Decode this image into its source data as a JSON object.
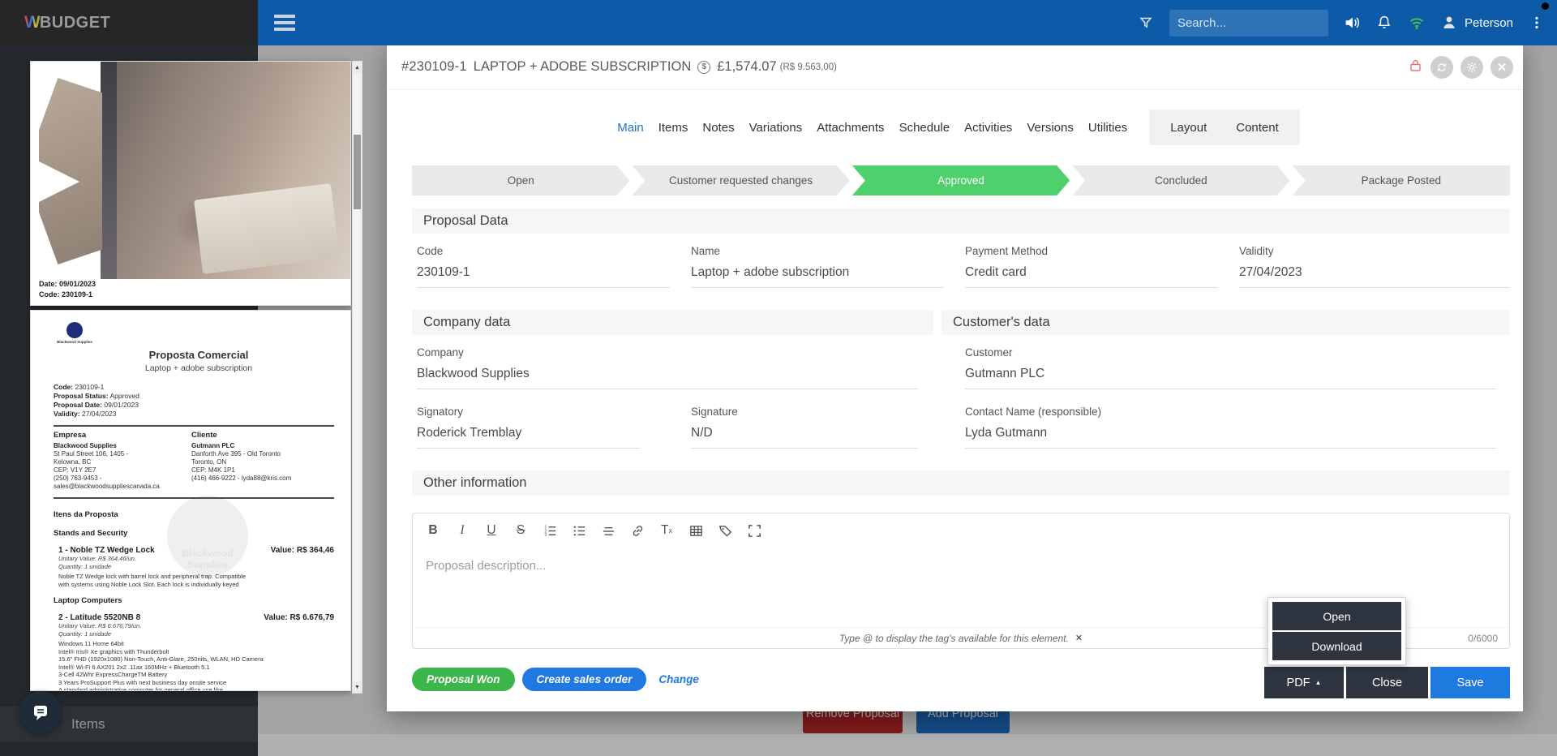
{
  "colors": {
    "topbar_blue": "#0d5aa8",
    "search_bg": "#2e73b5",
    "step_active_green": "#4ed06c",
    "pill_green": "#3cb54a",
    "action_blue": "#1f7ae0",
    "dark_button": "#2e3540",
    "lock_red": "#e57373",
    "remove_red": "#b71c1c",
    "add_blue": "#1565c0",
    "wifi_green": "#43c64a",
    "active_tab_blue": "#1f76c2"
  },
  "topbar": {
    "logo_w": "W",
    "logo_rest": "BUDGET",
    "search_placeholder": "Search...",
    "user_name": "Peterson"
  },
  "sidebar": {
    "items_label": "Items"
  },
  "background": {
    "remove_proposal": "Remove Proposal",
    "add_proposal": "Add Proposal"
  },
  "modal": {
    "title": {
      "code": "#230109-1",
      "name": "LAPTOP + ADOBE SUBSCRIPTION",
      "currency_icon": "$",
      "amount": "£1,574.07",
      "amount_secondary": "(R$ 9.563,00)"
    },
    "tabs": [
      "Main",
      "Items",
      "Notes",
      "Variations",
      "Attachments",
      "Schedule",
      "Activities",
      "Versions",
      "Utilities"
    ],
    "active_tab": "Main",
    "layout_tabs": [
      "Layout",
      "Content"
    ],
    "steps": [
      "Open",
      "Customer requested changes",
      "Approved",
      "Concluded",
      "Package Posted"
    ],
    "active_step": "Approved",
    "sections": {
      "proposal_data": "Proposal Data",
      "company_data": "Company data",
      "customer_data": "Customer's data",
      "other_information": "Other information"
    },
    "fields": {
      "code": {
        "label": "Code",
        "value": "230109-1"
      },
      "name": {
        "label": "Name",
        "value": "Laptop + adobe subscription"
      },
      "payment_method": {
        "label": "Payment Method",
        "value": "Credit card"
      },
      "validity": {
        "label": "Validity",
        "value": "27/04/2023"
      },
      "company": {
        "label": "Company",
        "value": "Blackwood Supplies"
      },
      "signatory": {
        "label": "Signatory",
        "value": "Roderick Tremblay"
      },
      "signature": {
        "label": "Signature",
        "value": "N/D"
      },
      "customer": {
        "label": "Customer",
        "value": "Gutmann PLC"
      },
      "contact_name": {
        "label": "Contact Name (responsible)",
        "value": "Lyda Gutmann"
      }
    },
    "editor": {
      "toolbar": {
        "bold": "B",
        "italic": "I",
        "underline": "U",
        "strike": "S",
        "clear_t": "T",
        "clear_x": "x"
      },
      "placeholder": "Proposal description...",
      "hint": "Type @ to display the tag's available for this element.",
      "hint_close": "✕",
      "counter": "0/6000"
    },
    "actions": {
      "proposal_won": "Proposal Won",
      "create_sales_order": "Create sales order",
      "change": "Change",
      "pdf": "PDF",
      "close": "Close",
      "save": "Save",
      "dropdown": [
        "Open",
        "Download"
      ]
    }
  },
  "pdf_panel": {
    "cover": {
      "date_line": "Date: 09/01/2023",
      "code_line": "Code: 230109-1"
    },
    "document": {
      "logo_caption": "Blackwood Supplies",
      "title": "Proposta Comercial",
      "subtitle": "Laptop + adobe subscription",
      "meta": [
        {
          "label": "Code:",
          "value": "230109-1"
        },
        {
          "label": "Proposal Status:",
          "value": "Approved"
        },
        {
          "label": "Proposal Date:",
          "value": "09/01/2023"
        },
        {
          "label": "Validity:",
          "value": "27/04/2023"
        }
      ],
      "company_header": "Empresa",
      "company_name": "Blackwood Supplies",
      "company_lines": [
        "St Paul Street 106, 1405 -",
        "Kelowna, BC",
        "CEP: V1Y 2E7",
        "(250) 763-9453 -",
        "sales@blackwoodsuppliescanada.ca"
      ],
      "client_header": "Cliente",
      "client_name": "Gutmann PLC",
      "client_lines": [
        "Danforth Ave 395 - Old Toronto",
        "Toronto, ON",
        "CEP: M4K 1P1",
        "(416) 466-9222 - lyda88@kris.com"
      ],
      "items_header": "Itens da Proposta",
      "group1": "Stands and Security",
      "item1": {
        "title": "1 - Noble TZ Wedge Lock",
        "value": "Value: R$ 364,46",
        "unitary": "Unitary Value: R$ 364,46/un.",
        "quantity": "Quantity: 1 unidade",
        "description": [
          "Noble TZ Wedge lock with barrel lock and peripheral trap. Compatible",
          "with systems using Noble Lock Slot. Each lock is individually keyed"
        ]
      },
      "group2": "Laptop Computers",
      "item2": {
        "title": "2 - Latitude 5520NB 8",
        "value": "Value: R$ 6.676,79",
        "unitary": "Unitary Value: R$ 6.676,79/un.",
        "quantity": "Quantity: 1 unidade",
        "description": [
          "Windows 11 Home 64bit",
          "Intel® Iris® Xe graphics with Thunderbolt",
          "15.6\" FHD (1920x1080) Non-Touch, Anti-Glare, 250nits, WLAN, HD Camera",
          "Intel® Wi-Fi 6 AX201 2x2 .11ax 160MHz + Bluetooth 5.1",
          "3-Cell 42Whr ExpressChargeTM Battery",
          "3 Years ProSupport Plus with next business day onsite service",
          "A standard administrative computer for general office use like"
        ]
      },
      "watermark_line1": "Blackwood",
      "watermark_line2": "Supplies"
    }
  }
}
